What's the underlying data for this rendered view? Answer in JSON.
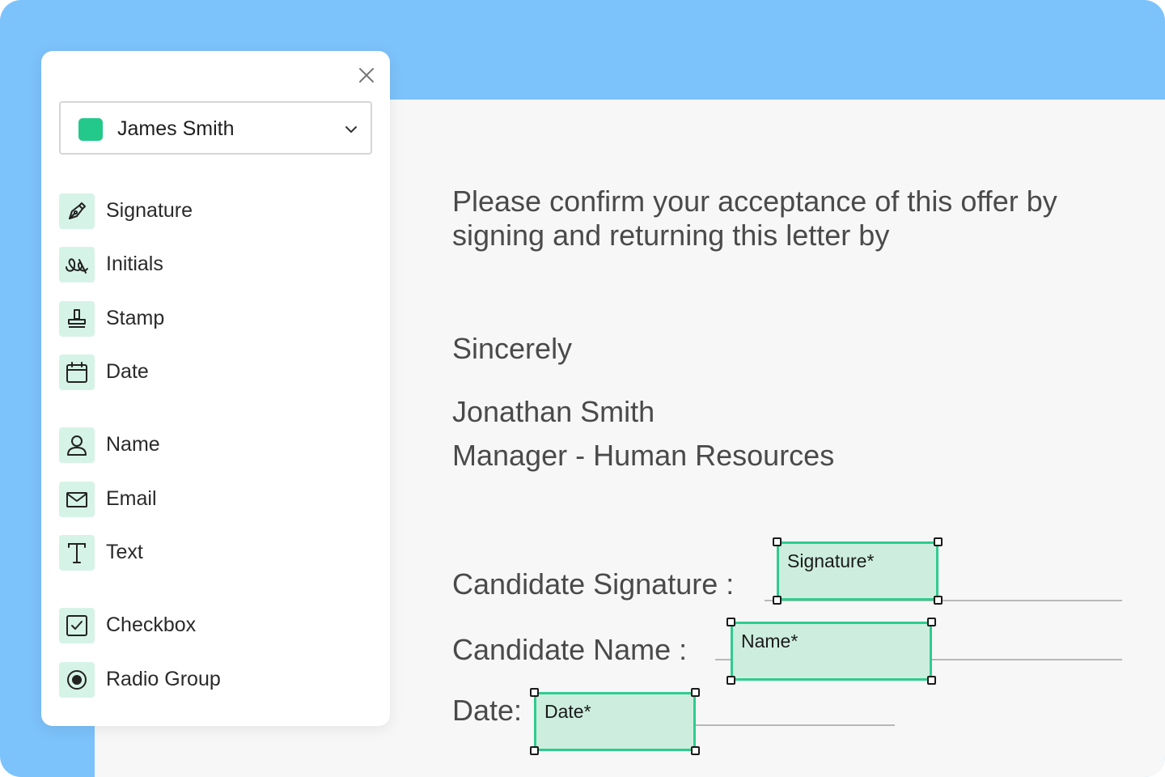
{
  "colors": {
    "frame": "#7cc2fb",
    "accent": "#22c98a",
    "field_fill": "#cdeedf",
    "field_border": "#2ecc8f"
  },
  "panel": {
    "close_icon": "close-icon",
    "signer": {
      "name": "James Smith",
      "color": "#22c98a"
    },
    "items": [
      {
        "label": "Signature",
        "icon": "pen-nib-icon"
      },
      {
        "label": "Initials",
        "icon": "initials-icon"
      },
      {
        "label": "Stamp",
        "icon": "stamp-icon"
      },
      {
        "label": "Date",
        "icon": "calendar-icon"
      },
      {
        "label": "Name",
        "icon": "person-icon"
      },
      {
        "label": "Email",
        "icon": "envelope-icon"
      },
      {
        "label": "Text",
        "icon": "text-icon"
      },
      {
        "label": "Checkbox",
        "icon": "checkbox-icon"
      },
      {
        "label": "Radio Group",
        "icon": "radio-icon"
      }
    ]
  },
  "document": {
    "paragraph_line1": "Please confirm your acceptance of this offer by",
    "paragraph_line2": "signing and returning this letter by",
    "closing": "Sincerely",
    "sender_name": "Jonathan Smith",
    "sender_title": "Manager - Human Resources",
    "signature_label": "Candidate Signature :",
    "name_label": "Candidate Name :",
    "date_label": "Date:"
  },
  "fields": {
    "signature": "Signature*",
    "name": "Name*",
    "date": "Date*"
  }
}
